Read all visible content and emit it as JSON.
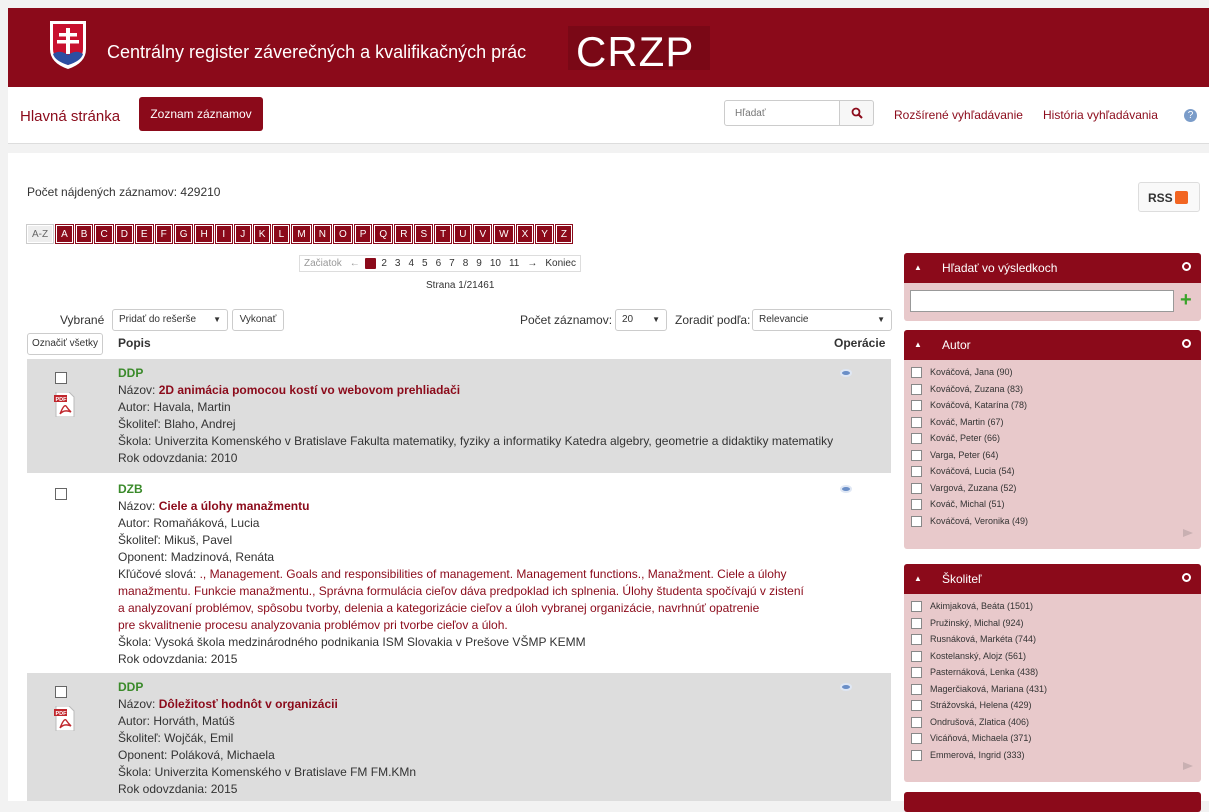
{
  "header": {
    "site_title": "Centrálny register záverečných a kvalifikačných prác",
    "logo_text": "CRZP"
  },
  "nav": {
    "home": "Hlavná stránka",
    "list": "Zoznam záznamov",
    "search_placeholder": "Hľadať",
    "advanced": "Rozšírené vyhľadávanie",
    "history": "História vyhľadávania"
  },
  "results": {
    "count_label": "Počet nájdených záznamov: 429210",
    "rss": "RSS"
  },
  "letters": [
    "A-Z",
    "A",
    "B",
    "C",
    "D",
    "E",
    "F",
    "G",
    "H",
    "I",
    "J",
    "K",
    "L",
    "M",
    "N",
    "O",
    "P",
    "Q",
    "R",
    "S",
    "T",
    "U",
    "V",
    "W",
    "X",
    "Y",
    "Z"
  ],
  "pager": {
    "start": "Začiatok",
    "prev": "←",
    "pages": [
      "1",
      "2",
      "3",
      "4",
      "5",
      "6",
      "7",
      "8",
      "9",
      "10",
      "11"
    ],
    "next": "→",
    "end": "Koniec",
    "info": "Strana 1/21461"
  },
  "controls": {
    "selected_label": "Vybrané",
    "selected_value": "Pridať do rešerše",
    "execute": "Vykonať",
    "per_page_label": "Počet záznamov:",
    "per_page_value": "20",
    "sort_label": "Zoradiť podľa:",
    "sort_value": "Relevancie",
    "mark_all": "Označiť všetky",
    "col_desc": "Popis",
    "col_ops": "Operácie"
  },
  "records": [
    {
      "type": "DDP",
      "title_label": "Názov:",
      "title": "2D animácia pomocou kostí vo webovom prehliadači",
      "author": "Autor: Havala, Martin",
      "supervisor": "Školiteľ: Blaho, Andrej",
      "school": "Škola: Univerzita Komenského v Bratislave Fakulta matematiky, fyziky a informatiky Katedra algebry, geometrie a didaktiky matematiky",
      "year": "Rok odovzdania: 2010"
    },
    {
      "type": "DZB",
      "title_label": "Názov:",
      "title": "Ciele a úlohy manažmentu",
      "author": "Autor: Romaňáková, Lucia",
      "supervisor": "Školiteľ: Mikuš, Pavel",
      "opponent": "Oponent: Madzinová, Renáta",
      "keywords_label": "Kľúčové slová:",
      "keywords_1": "., Management. Goals and responsibilities of management. Management functions., Manažment. Ciele a úlohy",
      "keywords_2": "manažmentu. Funkcie manažmentu., Správna formulácia cieľov dáva predpoklad ich splnenia. Úlohy študenta spočívajú v zistení",
      "keywords_3": "a analyzovaní problémov, spôsobu tvorby, delenia a kategorizácie cieľov a úloh vybranej organizácie, navrhnúť opatrenie",
      "keywords_4": "pre skvalitnenie procesu analyzovania problémov pri tvorbe cieľov a úloh.",
      "school": "Škola: Vysoká škola medzinárodného podnikania ISM Slovakia v Prešove VŠMP KEMM",
      "year": "Rok odovzdania: 2015"
    },
    {
      "type": "DDP",
      "title_label": "Názov:",
      "title": "Dôležitosť hodnôt v organizácii",
      "author": "Autor: Horváth, Matúš",
      "supervisor": "Školiteľ: Wojčák, Emil",
      "opponent": "Oponent: Poláková, Michaela",
      "school": "Škola: Univerzita Komenského v Bratislave FM FM.KMn",
      "year": "Rok odovzdania: 2015"
    }
  ],
  "panels": {
    "search": {
      "title": "Hľadať vo výsledkoch"
    },
    "author": {
      "title": "Autor",
      "items": [
        "Kováčová, Jana (90)",
        "Kováčová, Zuzana (83)",
        "Kováčová, Katarína (78)",
        "Kováč, Martin (67)",
        "Kováč, Peter (66)",
        "Varga, Peter (64)",
        "Kováčová, Lucia (54)",
        "Vargová, Zuzana (52)",
        "Kováč, Michal (51)",
        "Kováčová, Veronika (49)"
      ]
    },
    "supervisor": {
      "title": "Školiteľ",
      "items": [
        "Akimjaková, Beáta (1501)",
        "Pružinský, Michal (924)",
        "Rusnáková, Markéta (744)",
        "Kostelanský, Alojz (561)",
        "Pasternáková, Lenka (438)",
        "Magerčiaková, Mariana (431)",
        "Strážovská, Helena (429)",
        "Ondrušová, Zlatica (406)",
        "Vicáňová, Michaela (371)",
        "Emmerová, Ingrid (333)"
      ]
    }
  },
  "colors": {
    "brand": "#8b0a1a",
    "type_green": "#3a8a2a",
    "panel_bg": "#e8c9cb"
  }
}
